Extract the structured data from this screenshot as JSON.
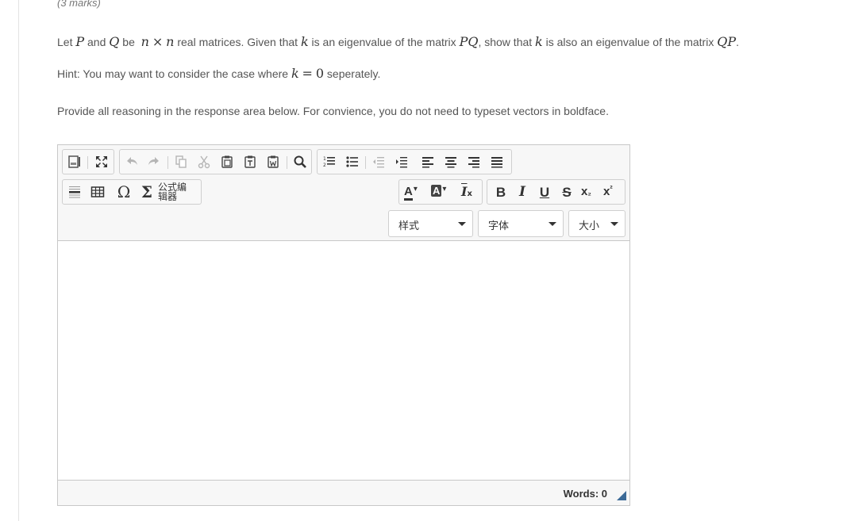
{
  "question": {
    "marks": "(3 marks)",
    "statement": {
      "t1": "Let ",
      "P": "P",
      "t2": " and ",
      "Q": "Q",
      "t3": " be ",
      "n1": "n",
      "times": "×",
      "n2": "n",
      "t4": " real matrices. Given that ",
      "k1": "k",
      "t5": " is an eigenvalue of the matrix ",
      "PQ": "PQ",
      "t6": ", show that ",
      "k2": "k",
      "t7": " is also an eigenvalue of the matrix ",
      "QP": "QP",
      "t8": "."
    },
    "hint": {
      "t1": "Hint: You may want to consider the case where ",
      "k": "k",
      "eq": "=",
      "zero": "0",
      "t2": " seperately."
    },
    "instructions": "Provide all reasoning in the response area below. For convience, you do not need to typeset vectors in boldface."
  },
  "editor": {
    "toolbar": {
      "row1_icons": [
        "source-icon",
        "maximize-icon",
        "undo-icon",
        "redo-icon",
        "copy-icon",
        "cut-icon",
        "paste-icon",
        "paste-text-icon",
        "paste-word-icon",
        "find-icon",
        "numbered-list-icon",
        "bulleted-list-icon",
        "outdent-icon",
        "indent-icon",
        "align-left-icon",
        "align-center-icon",
        "align-right-icon",
        "justify-icon"
      ],
      "formula_editor_label": "公式编辑器",
      "format": {
        "text_color": "A",
        "bg_color": "A",
        "remove_format": "I",
        "remove_format_sub": "x",
        "bold": "B",
        "italic": "I",
        "underline": "U",
        "strike": "S",
        "subscript": "x",
        "subscript_mark": "₂",
        "superscript": "x",
        "superscript_mark": "²"
      },
      "styles_label": "样式",
      "font_label": "字体",
      "size_label": "大小"
    },
    "content_text": "",
    "word_count": "Words: 0"
  },
  "colors": {
    "resize_handle": "#3c6a97",
    "text": "#555555"
  }
}
